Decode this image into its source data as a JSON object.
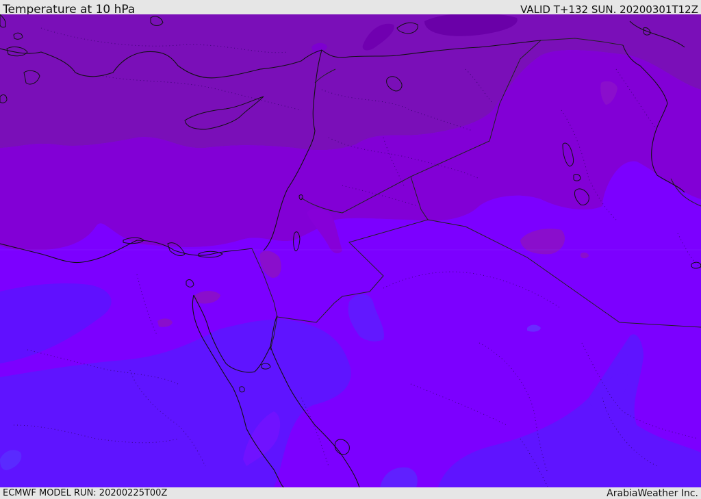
{
  "header": {
    "title": "Temperature at 10 hPa",
    "valid": "VALID T+132 SUN. 20200301T12Z"
  },
  "footer": {
    "model_run": "ECMWF MODEL RUN: 20200225T00Z",
    "credit": "ArabiaWeather Inc."
  },
  "map": {
    "colors": {
      "band_darkest": "#6a00a8",
      "band_dark": "#7a0fb8",
      "band_mid": "#8200d6",
      "band_light": "#8000ff",
      "band_lightest": "#6010ff",
      "band_blue": "#5a20ff",
      "coastline": "#111111",
      "border": "#222222"
    }
  }
}
